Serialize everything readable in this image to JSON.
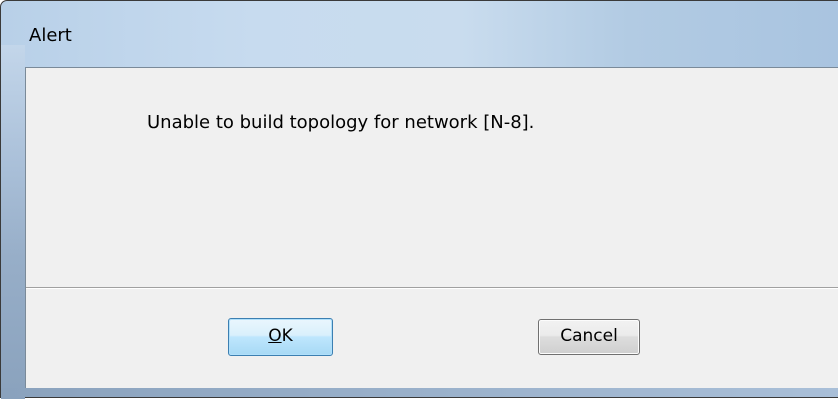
{
  "window": {
    "title": "Alert"
  },
  "dialog": {
    "message": "Unable to build topology for network [N-8]."
  },
  "buttons": {
    "ok": {
      "accel": "O",
      "rest": "K"
    },
    "cancel": {
      "label": "Cancel"
    }
  }
}
